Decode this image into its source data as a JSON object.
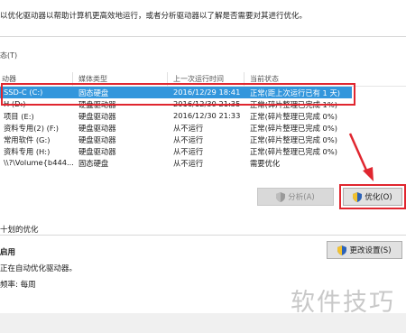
{
  "intro_text": "以优化驱动器以帮助计算机更高效地运行，或者分析驱动器以了解是否需要对其进行优化。",
  "status_label": "态(T)",
  "table": {
    "headers": [
      "动器",
      "媒体类型",
      "上一次运行时间",
      "当前状态"
    ],
    "rows": [
      {
        "drive": "SSD-C (C:)",
        "media": "固态硬盘",
        "last_run": "2016/12/29 18:41",
        "status": "正常(距上次运行已有 1 天)",
        "selected": true
      },
      {
        "drive": "H (D:)",
        "media": "硬盘驱动器",
        "last_run": "2016/12/30 21:35",
        "status": "正常(碎片整理已完成 1%)",
        "selected": false
      },
      {
        "drive": "项目 (E:)",
        "media": "硬盘驱动器",
        "last_run": "2016/12/30 21:33",
        "status": "正常(碎片整理已完成 0%)",
        "selected": false
      },
      {
        "drive": "资料专用(2) (F:)",
        "media": "硬盘驱动器",
        "last_run": "从不运行",
        "status": "正常(碎片整理已完成 0%)",
        "selected": false
      },
      {
        "drive": "常用软件 (G:)",
        "media": "硬盘驱动器",
        "last_run": "从不运行",
        "status": "正常(碎片整理已完成 0%)",
        "selected": false
      },
      {
        "drive": "资料专用 (H:)",
        "media": "硬盘驱动器",
        "last_run": "从不运行",
        "status": "正常(碎片整理已完成 0%)",
        "selected": false
      },
      {
        "drive": "\\\\?\\Volume{b444...",
        "media": "固态硬盘",
        "last_run": "从不运行",
        "status": "需要优化",
        "selected": false
      }
    ]
  },
  "buttons": {
    "analyze": "分析(A)",
    "optimize": "优化(O)",
    "change_settings": "更改设置(S)"
  },
  "scheduled": {
    "title": "十划的优化",
    "enabled": "启用",
    "description": "正在自动优化驱动器。",
    "frequency": "频率: 每周"
  },
  "watermark": "软件技巧",
  "colors": {
    "selection": "#3296dc",
    "annotation": "#e0262f"
  }
}
